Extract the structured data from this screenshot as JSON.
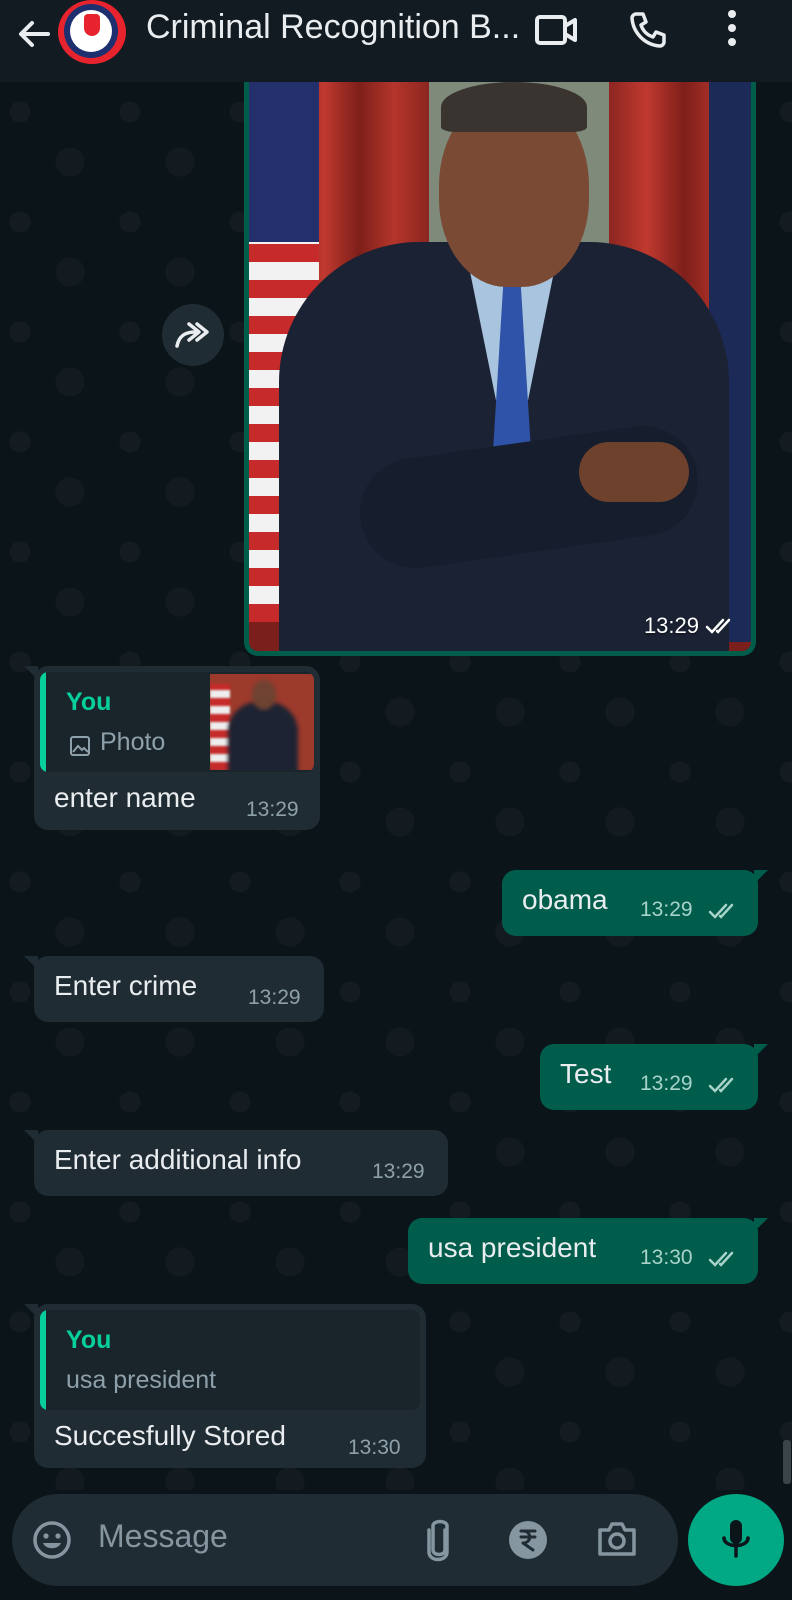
{
  "header": {
    "title": "Criminal Recognition B...",
    "back_icon": "arrow-left-icon",
    "video_icon": "video-call-icon",
    "call_icon": "phone-icon",
    "menu_icon": "more-vert-icon"
  },
  "messages": {
    "photo": {
      "time": "13:29"
    },
    "m1": {
      "quote_author": "You",
      "quote_text": "Photo",
      "text": "enter name",
      "time": "13:29"
    },
    "m2": {
      "text": "obama",
      "time": "13:29"
    },
    "m3": {
      "text": "Enter crime",
      "time": "13:29"
    },
    "m4": {
      "text": "Test",
      "time": "13:29"
    },
    "m5": {
      "text": "Enter additional info",
      "time": "13:29"
    },
    "m6": {
      "text": "usa president",
      "time": "13:30"
    },
    "m7": {
      "quote_author": "You",
      "quote_text": "usa president",
      "text": "Succesfully Stored",
      "time": "13:30"
    }
  },
  "input": {
    "placeholder": "Message"
  },
  "colors": {
    "header_bg": "#121b22",
    "chat_bg": "#0b1419",
    "incoming_bubble": "#202c33",
    "outgoing_bubble": "#005c4b",
    "accent": "#00a884",
    "quote_author": "#06cf9c",
    "read_ticks": "#a8d3c9"
  }
}
